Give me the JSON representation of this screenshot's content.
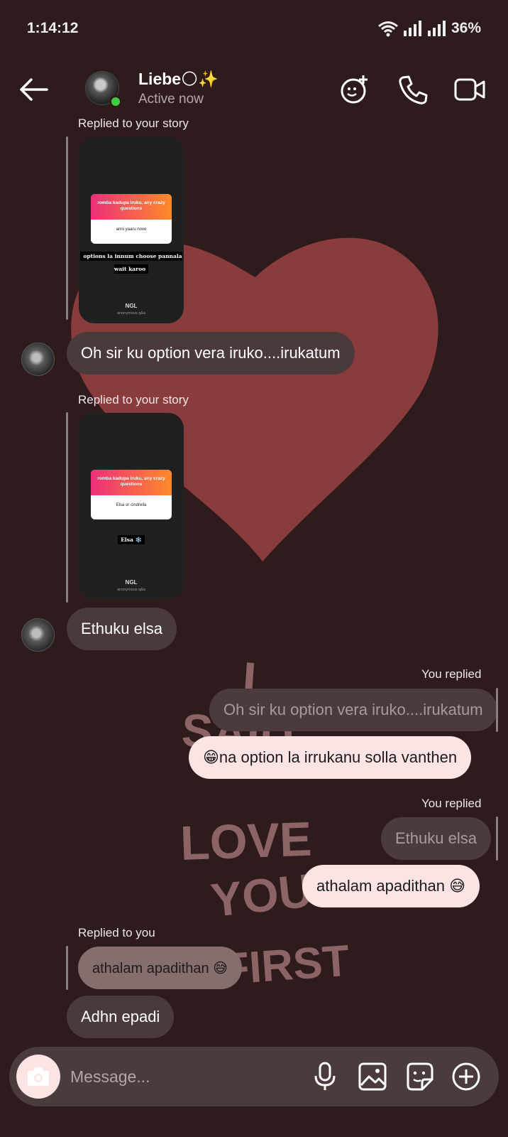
{
  "status": {
    "time": "1:14:12",
    "battery": "36%"
  },
  "header": {
    "contact_name": "Liebe🌕✨",
    "contact_status": "Active now"
  },
  "messages": {
    "story_reply_1_label": "Replied to your story",
    "story_1": {
      "question": "romba kadupa iruku, any crazy questions",
      "answer_text": "anni yaaru nove",
      "response": "options la innum choose pannala wait karoo",
      "brand": "NGL",
      "brand_sub": "anonymous q&a"
    },
    "msg_1": "Oh sir ku option vera iruko....irukatum",
    "story_reply_2_label": "Replied to your story",
    "story_2": {
      "question": "romba kadupa iruku, any crazy questions",
      "answer_text": "Elsa or cindrella",
      "response": "Elsa ❄️",
      "brand": "NGL",
      "brand_sub": "anonymous q&a"
    },
    "msg_2": "Ethuku elsa",
    "you_replied_1": "You replied",
    "quoted_1": "Oh sir ku option vera iruko....irukatum",
    "reply_1": "😁na option la irrukanu solla vanthen",
    "you_replied_2": "You replied",
    "quoted_2": "Ethuku elsa",
    "reply_2": "athalam apadithan 😅",
    "replied_to_you_label": "Replied to you",
    "quoted_3": "athalam apadithan 😅",
    "msg_3": "Adhn epadi"
  },
  "composer": {
    "placeholder": "Message..."
  },
  "background_art_text": "I SAID I LOVE YOU FIRST",
  "colors": {
    "background": "#2e1b1c",
    "heart": "#8a3b3c",
    "outgoing_bubble": "#fbe4e3",
    "incoming_bubble": "#4a3a3b"
  }
}
